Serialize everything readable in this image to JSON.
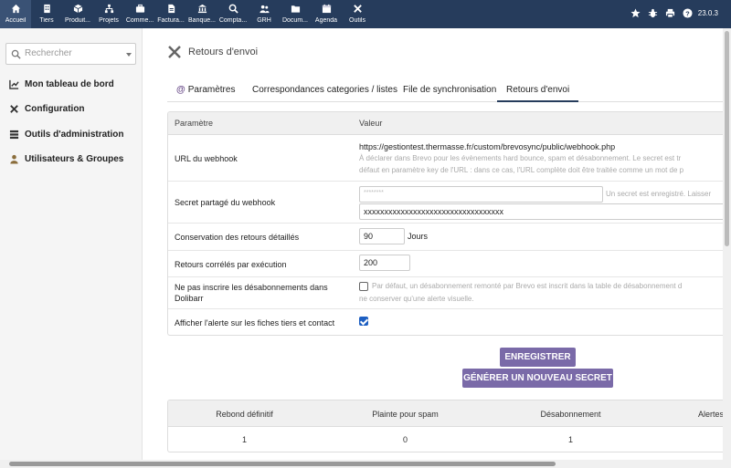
{
  "topnav": [
    {
      "label": "Accueil",
      "icon": "home-icon"
    },
    {
      "label": "Tiers",
      "icon": "building-icon"
    },
    {
      "label": "Produit...",
      "icon": "cube-icon"
    },
    {
      "label": "Projets",
      "icon": "sitemap-icon"
    },
    {
      "label": "Comme...",
      "icon": "suitcase-icon"
    },
    {
      "label": "Factura...",
      "icon": "document-icon"
    },
    {
      "label": "Banque...",
      "icon": "bank-icon"
    },
    {
      "label": "Compta...",
      "icon": "search-dollar-icon"
    },
    {
      "label": "GRH",
      "icon": "users-icon"
    },
    {
      "label": "Docum...",
      "icon": "folder-icon"
    },
    {
      "label": "Agenda",
      "icon": "calendar-icon"
    },
    {
      "label": "Outils",
      "icon": "tools-icon"
    }
  ],
  "topright": {
    "version": "23.0.3"
  },
  "sidebar": {
    "search_placeholder": "Rechercher",
    "items": [
      {
        "label": "Mon tableau de bord",
        "icon": "chart-line-icon"
      },
      {
        "label": "Configuration",
        "icon": "tools-icon"
      },
      {
        "label": "Outils d'administration",
        "icon": "server-icon"
      },
      {
        "label": "Utilisateurs & Groupes",
        "icon": "user-icon"
      }
    ]
  },
  "page": {
    "title": "Retours d'envoi"
  },
  "tabs": [
    {
      "label": "Paramètres",
      "prefix": "@"
    },
    {
      "label": "Correspondances categories / listes"
    },
    {
      "label": "File de synchronisation"
    },
    {
      "label": "Retours d'envoi"
    }
  ],
  "table": {
    "col_param": "Paramètre",
    "col_value": "Valeur",
    "webhook_label": "URL du webhook",
    "webhook_url": "https://gestiontest.thermasse.fr/custom/brevosync/public/webhook.php",
    "webhook_help1": "À déclarer dans Brevo pour les évènements hard bounce, spam et désabonnement. Le secret est tr",
    "webhook_help2": "défaut en paramètre key de l'URL : dans ce cas, l'URL complète doit être traitée comme un mot de p",
    "secret_label": "Secret partagé du webhook",
    "secret_placeholder": "********",
    "secret_help": "Un secret est enregistré. Laisser",
    "secret_value": "xxxxxxxxxxxxxxxxxxxxxxxxxxxxxxxxxx",
    "retention_label": "Conservation des retours détaillés",
    "retention_value": "90",
    "retention_unit": "Jours",
    "per_run_label": "Retours corrélés par exécution",
    "per_run_value": "200",
    "no_unsub_label": "Ne pas inscrire les désabonnements dans Dolibarr",
    "no_unsub_help1": "Par défaut, un désabonnement remonté par Brevo est inscrit dans la table de désabonnement d",
    "no_unsub_help2": "ne conserver qu'une alerte visuelle.",
    "no_unsub_checked": false,
    "alert_label": "Afficher l'alerte sur les fiches tiers et contact",
    "alert_checked": true
  },
  "buttons": {
    "save": "ENREGISTRER",
    "new_secret": "GÉNÉRER UN NOUVEAU SECRET"
  },
  "stats": {
    "headers": [
      "Rebond définitif",
      "Plainte pour spam",
      "Désabonnement",
      "Alertes"
    ],
    "values": [
      "1",
      "0",
      "1",
      ""
    ]
  },
  "colors": {
    "topbar": "#263c5c",
    "button": "#7a6aa8",
    "checkbox": "#1d5fc2"
  }
}
